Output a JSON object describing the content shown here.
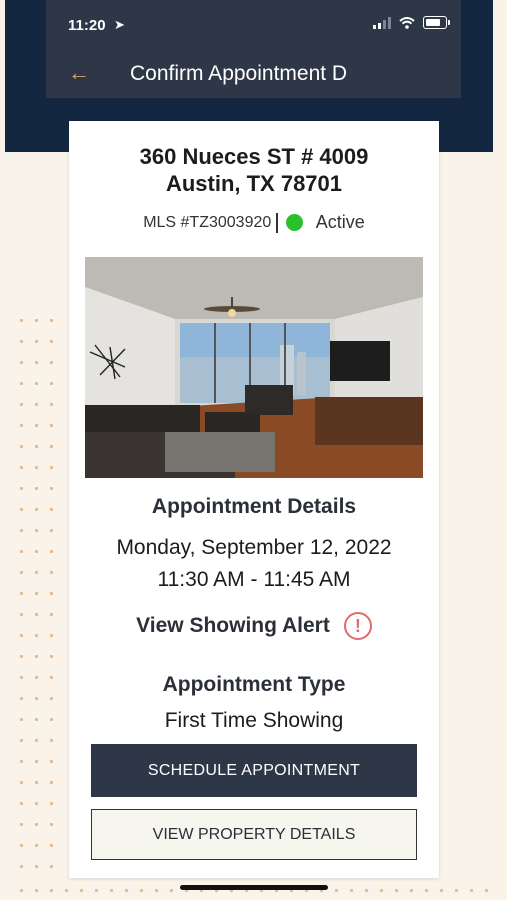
{
  "status_bar": {
    "time": "11:20",
    "location_glyph": "➤"
  },
  "header": {
    "title": "Confirm Appointment D",
    "back_glyph": "←"
  },
  "listing": {
    "address_line1": "360 Nueces ST # 4009",
    "address_line2": "Austin, TX 78701",
    "mls": "MLS #TZ3003920",
    "status": "Active",
    "status_color": "#29c22b"
  },
  "appointment": {
    "heading": "Appointment Details",
    "date": "Monday, September 12, 2022",
    "time": "11:30 AM - 11:45 AM",
    "alert_label": "View Showing Alert",
    "alert_glyph": "!",
    "type_heading": "Appointment Type",
    "type_value": "First Time Showing"
  },
  "actions": {
    "schedule": "SCHEDULE APPOINTMENT",
    "view_details": "VIEW PROPERTY DETAILS"
  },
  "colors": {
    "navy": "#142741",
    "header": "#2e3748",
    "accent": "#e0a35a",
    "alert": "#e36b6b"
  }
}
